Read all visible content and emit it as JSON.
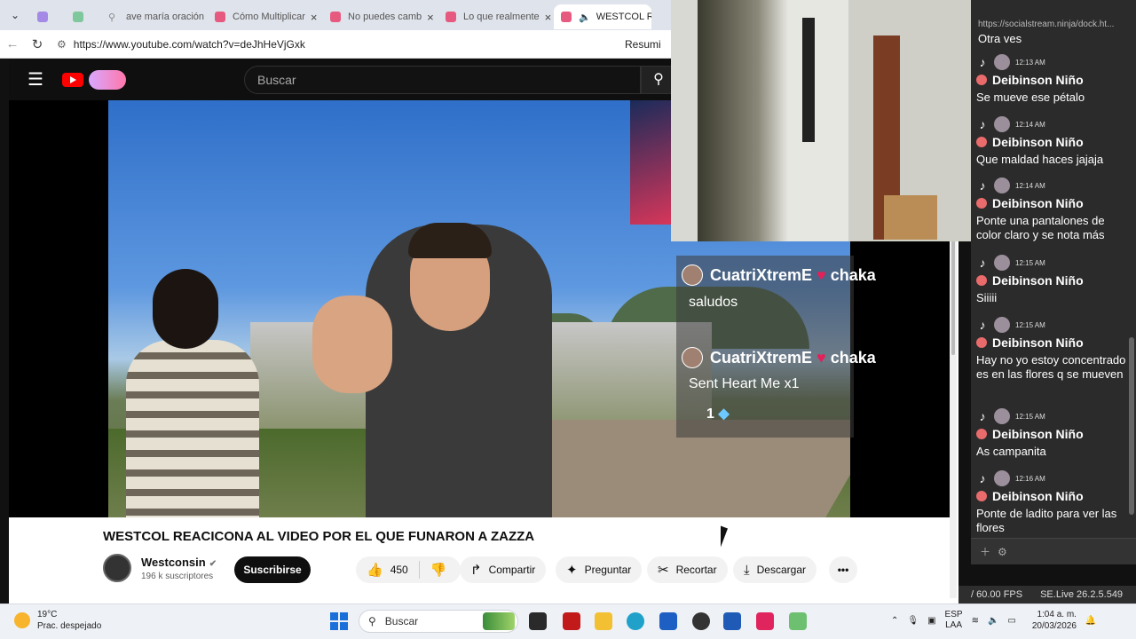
{
  "browser": {
    "tabs": [
      {
        "label": "",
        "color": "#a48ae6"
      },
      {
        "label": "",
        "color": "#7fc79c"
      },
      {
        "label": "ave maría oración",
        "color": "#999999"
      },
      {
        "label": "Cómo Multiplicar",
        "color": "#e65a7f"
      },
      {
        "label": "No puedes camb",
        "color": "#e65a7f"
      },
      {
        "label": "Lo que realmente",
        "color": "#e65a7f"
      },
      {
        "label": "WESTCOL RE",
        "color": "#e65a7f"
      }
    ],
    "url": "https://www.youtube.com/watch?v=deJhHeVjGxk",
    "resume_label": "Resumi"
  },
  "youtube": {
    "search_placeholder": "Buscar",
    "video_title": "WESTCOL REACICONA AL VIDEO POR EL QUE FUNARON A ZAZZA",
    "channel": "Westconsin",
    "subscribers": "196 k suscriptores",
    "subscribe_label": "Suscribirse",
    "likes": "450",
    "share_label": "Compartir",
    "ask_label": "Preguntar",
    "clip_label": "Recortar",
    "download_label": "Descargar"
  },
  "overlay": {
    "user1": "CuatriXtremE",
    "tag1": "chaka",
    "msg1": "saludos",
    "user2": "CuatriXtremE",
    "tag2": "chaka",
    "msg2": "Sent Heart Me x1",
    "count": "1"
  },
  "chat": {
    "url": "https://socialstream.ninja/dock.ht...",
    "top_text": "Otra ves",
    "messages": [
      {
        "time": "12:13 AM",
        "user": "Deibinson Niño",
        "text": "Se mueve ese pétalo"
      },
      {
        "time": "12:14 AM",
        "user": "Deibinson Niño",
        "text": "Que maldad haces jajaja"
      },
      {
        "time": "12:14 AM",
        "user": "Deibinson Niño",
        "text": "Ponte una pantalones de color claro y se nota más"
      },
      {
        "time": "12:15 AM",
        "user": "Deibinson Niño",
        "text": "Siiiii"
      },
      {
        "time": "12:15 AM",
        "user": "Deibinson Niño",
        "text": "Hay no yo estoy concentrado es en las flores q se mueven"
      },
      {
        "time": "12:15 AM",
        "user": "Deibinson Niño",
        "text": "As campanita"
      },
      {
        "time": "12:16 AM",
        "user": "Deibinson Niño",
        "text": "Ponte de ladito para ver las flores"
      }
    ]
  },
  "status": {
    "fps": "/ 60.00 FPS",
    "version": "SE.Live 26.2.5.549"
  },
  "taskbar": {
    "temp": "19°C",
    "weather": "Prac. despejado",
    "search": "Buscar",
    "lang1": "ESP",
    "lang2": "LAA",
    "time": "1:04 a. m.",
    "date": "20/03/2026"
  }
}
